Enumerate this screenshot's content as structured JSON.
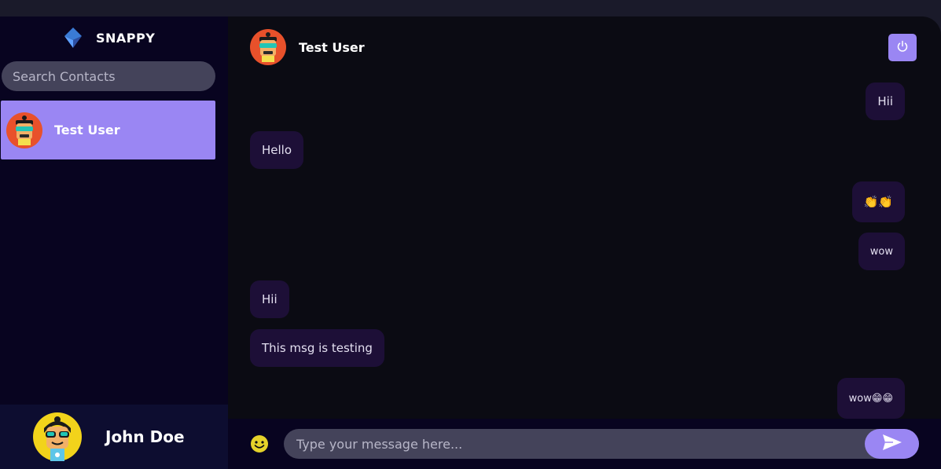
{
  "brand": {
    "name": "SNAPPY",
    "icon": "snappy-logo-icon"
  },
  "search": {
    "placeholder": "Search Contacts"
  },
  "contacts": [
    {
      "name": "Test User",
      "avatar": "avatar-icon",
      "selected": true
    }
  ],
  "current_user": {
    "name": "John Doe",
    "avatar": "avatar-icon"
  },
  "chat": {
    "header": {
      "name": "Test User",
      "logout_icon": "power-icon"
    },
    "messages": [
      {
        "text": "Hii",
        "direction": "sent"
      },
      {
        "text": "Hello",
        "direction": "received"
      },
      {
        "text": "👏👏",
        "direction": "sent"
      },
      {
        "text": "wow",
        "direction": "sent"
      },
      {
        "text": "Hii",
        "direction": "received"
      },
      {
        "text": "This msg is testing",
        "direction": "received"
      },
      {
        "text": "wow😁😁",
        "direction": "sent"
      }
    ],
    "input": {
      "placeholder": "Type your message here...",
      "emoji_icon": "smiley-icon",
      "send_icon": "send-icon"
    }
  },
  "colors": {
    "accent": "#9a86f3",
    "sidebar_bg": "#080420",
    "chat_bg": "#0b0b13",
    "bubble_bg": "#1d0f37",
    "input_bg": "#44435a"
  }
}
